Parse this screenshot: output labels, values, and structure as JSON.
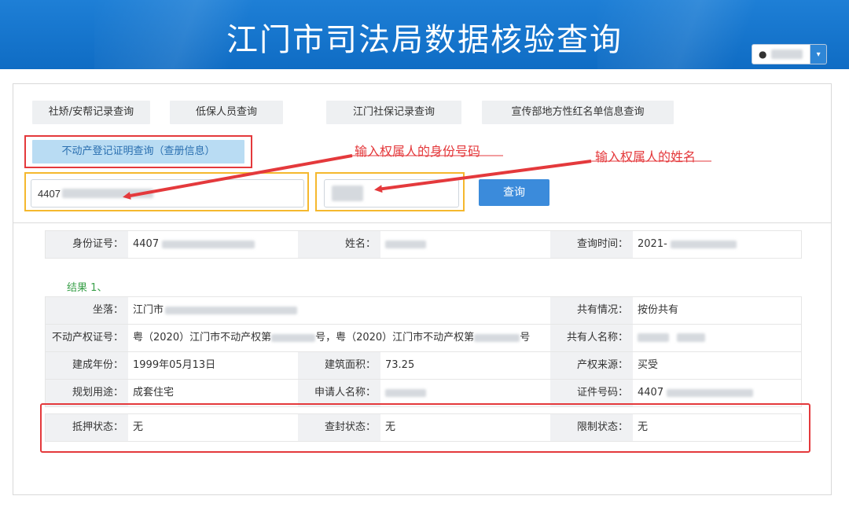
{
  "header": {
    "title": "江门市司法局数据核验查询",
    "user_icon": "user-icon",
    "caret_glyph": "▾"
  },
  "tabs": [
    {
      "label": "社矫/安帮记录查询"
    },
    {
      "label": "低保人员查询"
    },
    {
      "label": "江门社保记录查询"
    },
    {
      "label": "宣传部地方性红名单信息查询"
    },
    {
      "label": "不动产登记证明查询（查册信息）"
    }
  ],
  "search": {
    "id_value": "4407",
    "query_button": "查询"
  },
  "annotations": {
    "id_hint": "输入权属人的身份号码",
    "name_hint": "输入权属人的姓名"
  },
  "summary": {
    "id_label": "身份证号：",
    "id_value": "4407",
    "name_label": "姓名：",
    "time_label": "查询时间：",
    "time_value": "2021-"
  },
  "result": {
    "title": "结果 1、",
    "location_label": "坐落：",
    "location_value": "江门市",
    "share_label": "共有情况：",
    "share_value": "按份共有",
    "cert_label": "不动产权证号：",
    "cert_value_a": "粤（2020）江门市不动产权第",
    "cert_mid": "号，粤（2020）江门市不动产权第",
    "cert_end": "号",
    "co_owner_label": "共有人名称：",
    "year_label": "建成年份：",
    "year_value": "1999年05月13日",
    "area_label": "建筑面积：",
    "area_value": "73.25",
    "source_label": "产权来源：",
    "source_value": "买受",
    "usage_label": "规划用途：",
    "usage_value": "成套住宅",
    "applicant_label": "申请人名称：",
    "cardno_label": "证件号码：",
    "cardno_value": "4407",
    "mortgage_label": "抵押状态：",
    "mortgage_value": "无",
    "seal_label": "查封状态：",
    "seal_value": "无",
    "limit_label": "限制状态：",
    "limit_value": "无"
  },
  "colors": {
    "header_blue": "#1470c8",
    "highlight_red": "#e4393c",
    "highlight_yellow": "#f5b82e",
    "result_green": "#3aa04a"
  }
}
